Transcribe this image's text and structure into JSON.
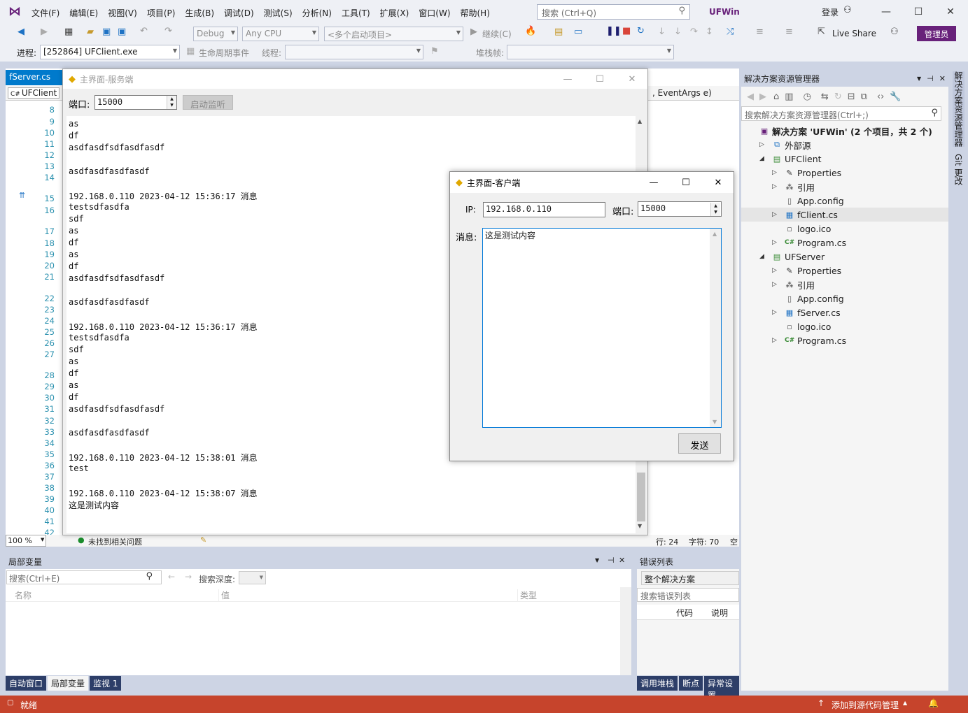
{
  "menu": {
    "items": [
      "文件(F)",
      "编辑(E)",
      "视图(V)",
      "项目(P)",
      "生成(B)",
      "调试(D)",
      "测试(S)",
      "分析(N)",
      "工具(T)",
      "扩展(X)",
      "窗口(W)",
      "帮助(H)"
    ],
    "search_placeholder": "搜索 (Ctrl+Q)",
    "solution_title": "UFWin",
    "login": "登录"
  },
  "toolbar": {
    "config": "Debug",
    "platform": "Any CPU",
    "startup": "<多个启动项目>",
    "continue": "继续(C)",
    "live_share": "Live Share",
    "admin": "管理员"
  },
  "debugbar": {
    "process_label": "进程:",
    "process_value": "[252864] UFClient.exe",
    "lifecycle": "生命周期事件",
    "thread_label": "线程:",
    "stackframe_label": "堆栈帧:"
  },
  "editor": {
    "tab_active": "fServer.cs",
    "nav_project": "UFClient",
    "nav_member": ", EventArgs e)",
    "line_numbers": [
      "8",
      "9",
      "10",
      "11",
      "12",
      "13",
      "14",
      "15",
      "16",
      "17",
      "18",
      "19",
      "20",
      "21",
      "22",
      "23",
      "24",
      "25",
      "26",
      "27",
      "28",
      "29",
      "30",
      "31",
      "32",
      "33",
      "34",
      "35",
      "36",
      "37",
      "38",
      "39",
      "40",
      "41",
      "42"
    ],
    "zoom": "100 %",
    "issues": "未找到相关问题",
    "row": "行: 24",
    "col": "字符: 70",
    "space": "空"
  },
  "server": {
    "title": "主界面-服务端",
    "port_label": "端口:",
    "port_value": "15000",
    "start_button": "启动监听",
    "lines": [
      "as",
      "df",
      "asdfasdfsdfasdfasdf",
      "",
      "asdfasdfasdfasdf",
      "",
      "192.168.0.110 2023-04-12 15:36:17 消息",
      "testsdfasdfa",
      "sdf",
      "as",
      "df",
      "as",
      "df",
      "asdfasdfsdfasdfasdf",
      "",
      "asdfasdfasdfasdf",
      "",
      "192.168.0.110 2023-04-12 15:36:17 消息",
      "testsdfasdfa",
      "sdf",
      "as",
      "df",
      "as",
      "df",
      "asdfasdfsdfasdfasdf",
      "",
      "asdfasdfasdfasdf",
      "",
      "192.168.0.110 2023-04-12 15:38:01 消息",
      "test",
      "",
      "192.168.0.110 2023-04-12 15:38:07 消息",
      "这是测试内容"
    ]
  },
  "client": {
    "title": "主界面-客户端",
    "ip_label": "IP:",
    "ip_value": "192.168.0.110",
    "port_label": "端口:",
    "port_value": "15000",
    "msg_label": "消息:",
    "msg_value": "这是测试内容",
    "send_button": "发送"
  },
  "solution_explorer": {
    "title": "解决方案资源管理器",
    "search_placeholder": "搜索解决方案资源管理器(Ctrl+;)",
    "items": [
      {
        "label": "解决方案 'UFWin' (2 个项目，共 2 个)",
        "icon": "solution-icon",
        "bold": true
      },
      {
        "label": "外部源",
        "icon": "external-icon"
      },
      {
        "label": "UFClient",
        "icon": "csproj-icon"
      },
      {
        "label": "Properties",
        "icon": "wrench-icon"
      },
      {
        "label": "引用",
        "icon": "reference-icon"
      },
      {
        "label": "App.config",
        "icon": "config-icon"
      },
      {
        "label": "fClient.cs",
        "icon": "form-icon"
      },
      {
        "label": "logo.ico",
        "icon": "image-icon"
      },
      {
        "label": "Program.cs",
        "icon": "csharp-icon"
      },
      {
        "label": "UFServer",
        "icon": "csproj-icon"
      },
      {
        "label": "Properties",
        "icon": "wrench-icon"
      },
      {
        "label": "引用",
        "icon": "reference-icon"
      },
      {
        "label": "App.config",
        "icon": "config-icon"
      },
      {
        "label": "fServer.cs",
        "icon": "form-icon"
      },
      {
        "label": "logo.ico",
        "icon": "image-icon"
      },
      {
        "label": "Program.cs",
        "icon": "csharp-icon"
      }
    ]
  },
  "rail": {
    "tab1": "解决方案资源管理器",
    "tab2": "Git 更改"
  },
  "locals": {
    "title": "局部变量",
    "search_placeholder": "搜索(Ctrl+E)",
    "depth_label": "搜索深度:",
    "col_name": "名称",
    "col_value": "值",
    "col_type": "类型",
    "tabs": [
      "自动窗口",
      "局部变量",
      "监视 1"
    ]
  },
  "errors": {
    "title": "错误列表",
    "scope": "整个解决方案",
    "search_placeholder": "搜索错误列表",
    "col_code": "代码",
    "col_desc": "说明",
    "tabs": [
      "调用堆栈",
      "断点",
      "异常设置"
    ]
  },
  "statusbar": {
    "ready": "就绪",
    "source_control": "添加到源代码管理"
  }
}
